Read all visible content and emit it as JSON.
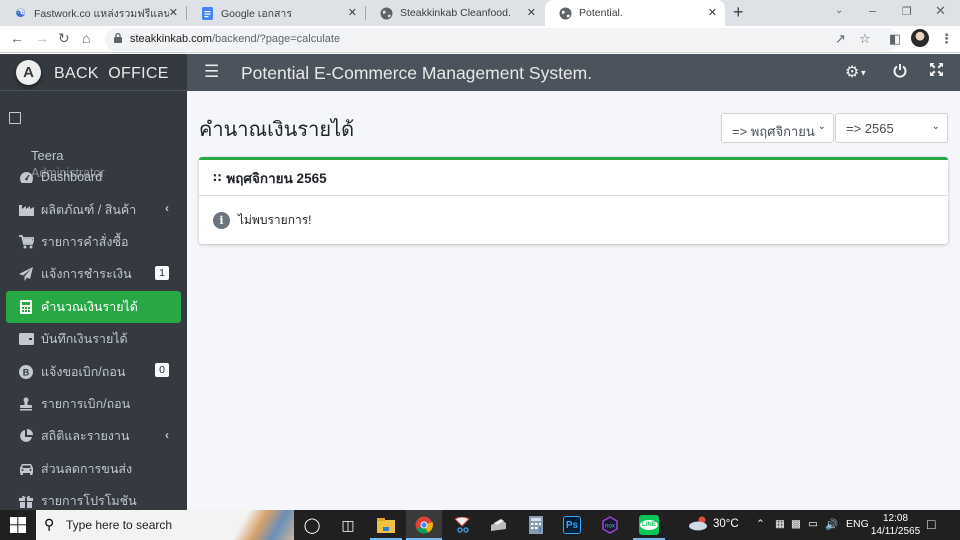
{
  "browser": {
    "tabs": [
      {
        "title": "Fastwork.co แหล่งรวมฟรีแลนซ์คุณภ",
        "icon": "fastwork-icon",
        "active": false
      },
      {
        "title": "Google เอกสาร",
        "icon": "google-docs-icon",
        "active": false
      },
      {
        "title": "Steakkinkab Cleanfood.",
        "icon": "globe-icon",
        "active": false
      },
      {
        "title": "Potential.",
        "icon": "globe-icon",
        "active": true
      }
    ],
    "new_tab": "+",
    "url_domain": "steakkinkab.com",
    "url_path": "/backend/?page=calculate"
  },
  "sidebar": {
    "brand": "BACK  OFFICE",
    "brand_logo": "A",
    "user_name": "Teera",
    "user_role": "Administrator",
    "items": [
      {
        "label": "Dashboard",
        "icon": "tachometer-icon"
      },
      {
        "label": "ผลิตภัณฑ์ / สินค้า",
        "icon": "industry-icon",
        "has_submenu": true
      },
      {
        "label": "รายการคำสั่งซื้อ",
        "icon": "cart-icon"
      },
      {
        "label": "แจ้งการชำระเงิน",
        "icon": "paper-plane-icon",
        "badge": "1"
      },
      {
        "label": "คำนวณเงินรายได้",
        "icon": "calculator-icon",
        "active": true
      },
      {
        "label": "บันทึกเงินรายได้",
        "icon": "wallet-icon"
      },
      {
        "label": "แจ้งขอเบิก/ถอน",
        "icon": "bitcoin-icon",
        "badge": "0"
      },
      {
        "label": "รายการเบิก/ถอน",
        "icon": "stamp-icon"
      },
      {
        "label": "สถิติและรายงาน",
        "icon": "chart-pie-icon",
        "has_submenu": true
      },
      {
        "label": "ส่วนลดการขนส่ง",
        "icon": "car-icon"
      },
      {
        "label": "รายการโปรโมชัน",
        "icon": "gift-icon"
      }
    ]
  },
  "topnav": {
    "title": "Potential E-Commerce Management System."
  },
  "main": {
    "page_title": "คำนาณเงินรายได้",
    "month_select": "=> พฤศจิกายน",
    "year_select": "=> 2565",
    "card_title": "พฤศจิกายน 2565",
    "empty_message": "ไม่พบรายการ!",
    "accent_color": "#28a745"
  },
  "taskbar": {
    "search_placeholder": "Type here to search",
    "weather": "30°C",
    "language": "ENG",
    "time": "12:08",
    "date": "14/11/2565"
  }
}
